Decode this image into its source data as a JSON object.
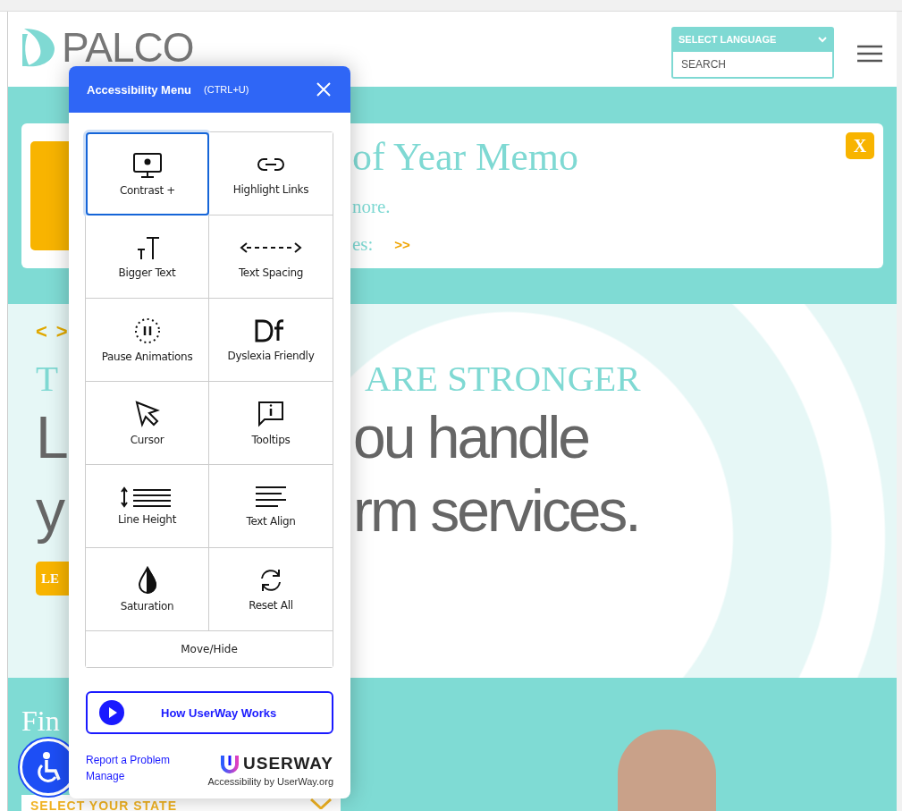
{
  "header": {
    "logo_text": "PALCO",
    "language_select": {
      "label": "SELECT LANGUAGE"
    },
    "search": {
      "placeholder": "SEARCH"
    }
  },
  "memo": {
    "title": "of Year Memo",
    "line_1": "nore.",
    "line_2": "es:",
    "link": ">>",
    "close": "X"
  },
  "hero": {
    "arrows": [
      "<",
      ">"
    ],
    "heading_left": "T",
    "heading_right": "ARE STRONGER",
    "lead": [
      {
        "left": "L",
        "right": "ou handle"
      },
      {
        "left": "y",
        "right": "rm services."
      }
    ],
    "button": "LE"
  },
  "find": {
    "title": "Fin",
    "state_select": {
      "label": "SELECT YOUR STATE"
    }
  },
  "accessibility_menu": {
    "title": "Accessibility Menu",
    "shortcut": "(CTRL+U)",
    "tools": [
      {
        "label": "Contrast +",
        "selected": true
      },
      {
        "label": "Highlight Links",
        "selected": false
      },
      {
        "label": "Bigger Text",
        "selected": false
      },
      {
        "label": "Text Spacing",
        "selected": false
      },
      {
        "label": "Pause Animations",
        "selected": false
      },
      {
        "label": "Dyslexia Friendly",
        "selected": false
      },
      {
        "label": "Cursor",
        "selected": false
      },
      {
        "label": "Tooltips",
        "selected": false
      },
      {
        "label": "Line Height",
        "selected": false
      },
      {
        "label": "Text Align",
        "selected": false
      },
      {
        "label": "Saturation",
        "selected": false
      },
      {
        "label": "Reset All",
        "selected": false
      }
    ],
    "move_hide": "Move/Hide",
    "how_button": "How UserWay Works",
    "report_link": "Report a Problem",
    "manage_link": "Manage",
    "brand": "USERWAY",
    "brand_tagline": "Accessibility by UserWay.org"
  }
}
